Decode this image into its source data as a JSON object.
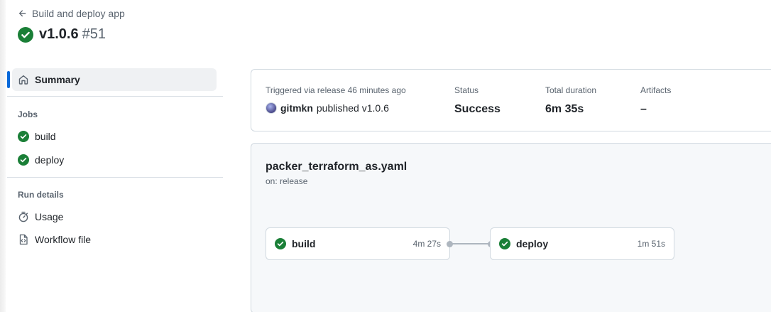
{
  "header": {
    "back_label": "Build and deploy app",
    "run_name": "v1.0.6",
    "run_number": "#51"
  },
  "sidebar": {
    "summary_label": "Summary",
    "jobs_heading": "Jobs",
    "jobs": [
      {
        "label": "build",
        "icon": "check-circle-icon"
      },
      {
        "label": "deploy",
        "icon": "check-circle-icon"
      }
    ],
    "run_details_heading": "Run details",
    "run_details": [
      {
        "label": "Usage",
        "icon": "stopwatch-icon"
      },
      {
        "label": "Workflow file",
        "icon": "file-code-icon"
      }
    ]
  },
  "summary": {
    "trigger_label": "Triggered via release 46 minutes ago",
    "user": "gitmkn",
    "action": "published v1.0.6",
    "status_label": "Status",
    "status_value": "Success",
    "duration_label": "Total duration",
    "duration_value": "6m 35s",
    "artifacts_label": "Artifacts",
    "artifacts_value": "–"
  },
  "workflow": {
    "file": "packer_terraform_as.yaml",
    "trigger": "on: release",
    "jobs": [
      {
        "name": "build",
        "duration": "4m 27s",
        "status": "success"
      },
      {
        "name": "deploy",
        "duration": "1m 51s",
        "status": "success"
      }
    ]
  },
  "colors": {
    "success": "#1a7f37",
    "accent": "#0969da",
    "muted_text": "#59636e"
  }
}
